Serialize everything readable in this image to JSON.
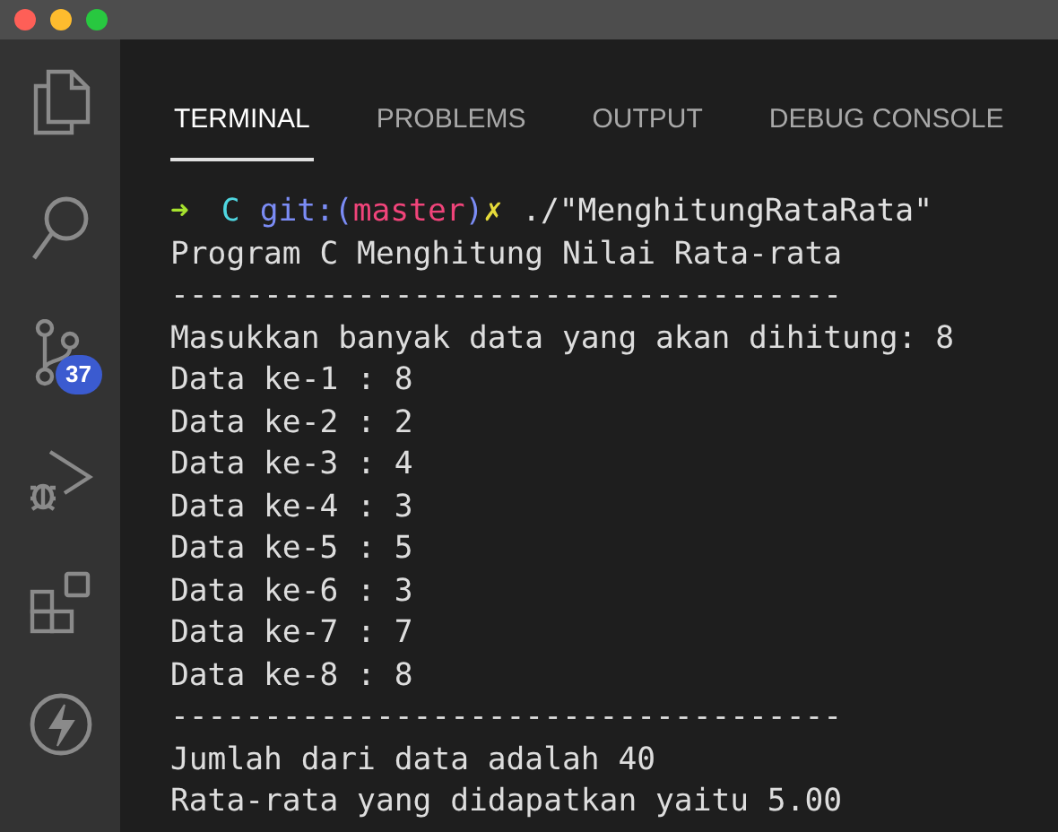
{
  "activity_bar": {
    "source_control_badge": "37"
  },
  "tabs": [
    {
      "label": "TERMINAL",
      "selected": true
    },
    {
      "label": "PROBLEMS",
      "selected": false
    },
    {
      "label": "OUTPUT",
      "selected": false
    },
    {
      "label": "DEBUG CONSOLE",
      "selected": false
    }
  ],
  "terminal": {
    "prompt": [
      {
        "text": "➜",
        "kind": "arrow"
      },
      {
        "text": "C",
        "kind": "dir"
      },
      {
        "text": "git:(",
        "kind": "git"
      },
      {
        "text": "master",
        "kind": "branch"
      },
      {
        "text": ")",
        "kind": "git"
      },
      {
        "text": "✗",
        "kind": "dirty"
      },
      {
        "text": "./\"MenghitungRataRata\"",
        "kind": "command"
      }
    ],
    "lines": [
      "Program C Menghitung Nilai Rata-rata",
      "------------------------------------",
      "Masukkan banyak data yang akan dihitung: 8",
      "Data ke-1 : 8",
      "Data ke-2 : 2",
      "Data ke-3 : 4",
      "Data ke-4 : 3",
      "Data ke-5 : 5",
      "Data ke-6 : 3",
      "Data ke-7 : 7",
      "Data ke-8 : 8",
      "------------------------------------",
      "Jumlah dari data adalah 40",
      "Rata-rata yang didapatkan yaitu 5.00"
    ]
  }
}
